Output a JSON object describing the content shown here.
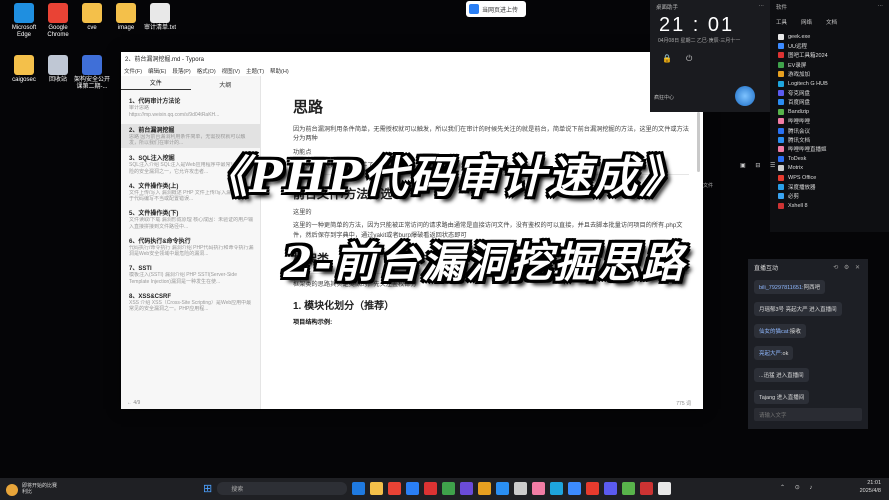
{
  "desktop": {
    "icons_row1": [
      {
        "label": "Microsoft Edge",
        "color": "#1f8fe0"
      },
      {
        "label": "Google Chrome",
        "color": "#e94335"
      },
      {
        "label": "cve",
        "color": "#f4c04a"
      },
      {
        "label": "image",
        "color": "#f4c04a"
      },
      {
        "label": "审计清单.txt",
        "color": "#e8e8e8"
      }
    ],
    "icons_row2": [
      {
        "label": "caigosec",
        "color": "#f4c04a"
      },
      {
        "label": "回收站",
        "color": "#bfc7d4"
      },
      {
        "label": "架构安全公开课第二期-...",
        "color": "#3f6fd8"
      }
    ]
  },
  "float_button": {
    "label": "当网页进上传"
  },
  "typora": {
    "title": "2、前台漏洞挖掘.md - Typora",
    "menu": [
      "文件(F)",
      "编辑(E)",
      "段落(P)",
      "格式(O)",
      "视图(V)",
      "主题(T)",
      "帮助(H)"
    ],
    "tabs": [
      "文件",
      "大纲"
    ],
    "outline": [
      {
        "heading": "1、代码审计方法论",
        "summary": "审计思路\nhttps://mp.weixin.qq.com/s/9d04tRaKH..."
      },
      {
        "heading": "2、前台漏洞挖掘",
        "summary": "思路 因为前台漏洞利用条件简单，无需授权就可以触发，所以我们在审计的..."
      },
      {
        "heading": "3、SQL注入挖掘",
        "summary": "SQL注入介绍 SQL注入是Web应用程序中最常见、最危险的安全漏洞之一，它允许攻击者..."
      },
      {
        "heading": "4、文件操作类(上)",
        "summary": "文件上传/写入 漏洞概述 PHP 文件上传/写入漏洞是指由于代码编写不当或配置错误..."
      },
      {
        "heading": "5、文件操作类(下)",
        "summary": "文件读取/下载 漏洞形成原理 核心成因：未验证的用户输入直接拼接到文件路径中..."
      },
      {
        "heading": "6、代码执行&命令执行",
        "summary": "代码执行/命令执行 漏洞介绍 PHP代码执行和命令执行漏洞是Web安全领域中最危险的漏洞..."
      },
      {
        "heading": "7、SSTI",
        "summary": "模板注入(SSTI) 漏洞介绍 PHP SSTI(Server-Side Template Injection)漏洞是一种发生在使..."
      },
      {
        "heading": "8、XSS&CSRF",
        "summary": "XSS 介绍 XSS（Cross-Site Scripting）是Web应用中最常见的安全漏洞之一。PHP应用程..."
      }
    ],
    "footer_left": "← 4/9",
    "word_count": "775 词",
    "editor": {
      "h1": "思路",
      "p1": "因为前台漏洞利用条件简单，无需授权就可以触发，所以我们在审计的时候先关注的就是前台，简单说下前台漏洞挖掘的方法，这里的文件或方法分为两种",
      "p2": "功能点",
      "p3": "主要就是围绕这两个点来讲了",
      "h2a": "前台文件/方法筛选",
      "p4": "这里的",
      "p5": "这里的一种更简单的方法，因为只能被正常访问的请求路由通常是直接访问文件，没有鉴权的可以直接，并且去脚本批量访问项目的所有.php文件，然后保存到字典中，通过yakit或者burp爆破看返回状态即可",
      "h2b": "框架类",
      "p6": "框架类的思路其实是类似的，先关注鉴权部分",
      "h3": "1. 模块化划分（推荐）",
      "p7": "项目结构示例:"
    }
  },
  "overlay": {
    "line1": "《PHP代码审计速成》",
    "line2": "2-前台漏洞挖掘思路"
  },
  "clock_widget": {
    "header_left": "桌面助手",
    "time": "21 : 01",
    "date": "04月08日  星期二  乙巳·庚辰·三月十一",
    "avatar_label": "疯狂中心"
  },
  "software_panel": {
    "title": "软件",
    "tabs": [
      "工具",
      "网络",
      "文档"
    ],
    "items": [
      {
        "name": "geek.exe",
        "color": "#e8e8e8"
      },
      {
        "name": "UU远程",
        "color": "#3c8bff"
      },
      {
        "name": "图吧工具箱2024",
        "color": "#d33"
      },
      {
        "name": "EV录屏",
        "color": "#3fa24b"
      },
      {
        "name": "游戏加加",
        "color": "#e7a020"
      },
      {
        "name": "Logitech G HUB",
        "color": "#1ea5dd"
      },
      {
        "name": "夸克网盘",
        "color": "#5b5bf0"
      },
      {
        "name": "百度网盘",
        "color": "#2b8cf3"
      },
      {
        "name": "Bandizip",
        "color": "#58b34b"
      },
      {
        "name": "哔哩哔哩",
        "color": "#f27da5"
      },
      {
        "name": "腾讯会议",
        "color": "#2a71f2"
      },
      {
        "name": "腾讯文档",
        "color": "#2a8ff2"
      },
      {
        "name": "哔哩哔哩直播姬",
        "color": "#f27da5"
      },
      {
        "name": "ToDesk",
        "color": "#2b6ff5"
      },
      {
        "name": "Motrix",
        "color": "#ccc"
      },
      {
        "name": "WPS Office",
        "color": "#e63b2e"
      },
      {
        "name": "深度播放器",
        "color": "#2aa0e8"
      },
      {
        "name": "必剪",
        "color": "#3aa4f0"
      },
      {
        "name": "Xshell 8",
        "color": "#c33"
      }
    ]
  },
  "side_note": "文件",
  "live_chat": {
    "title": "直播互动",
    "messages": [
      {
        "user": "bili_79297811651:",
        "text": "阿西吧"
      },
      {
        "user": "",
        "text": "月瑶郁3号 亮起大严 进入直播间"
      },
      {
        "user": "仙女的猫cat:",
        "text": "接收"
      },
      {
        "user": "亮起大严:",
        "text": "ok"
      },
      {
        "user": "",
        "text": "...迅猛 进入直播间"
      },
      {
        "user": "",
        "text": "Tajang 进入直播间"
      }
    ],
    "input_placeholder": "请输入文字"
  },
  "taskbar": {
    "weather_line1": "即将开始的比赛",
    "weather_line2": "利比",
    "search_placeholder": "搜索",
    "time": "21:01",
    "date": "2025/4/8",
    "app_colors": [
      "#1f7ae0",
      "#f4c04a",
      "#e94335",
      "#2a7ff5",
      "#d33",
      "#3fa24b",
      "#6a4bd8",
      "#e7a020",
      "#2a8ff2",
      "#ccc",
      "#f27da5",
      "#1ea5dd",
      "#3c8bff",
      "#e63b2e",
      "#5b5bf0",
      "#58b34b",
      "#c33",
      "#e8e8e8"
    ]
  }
}
